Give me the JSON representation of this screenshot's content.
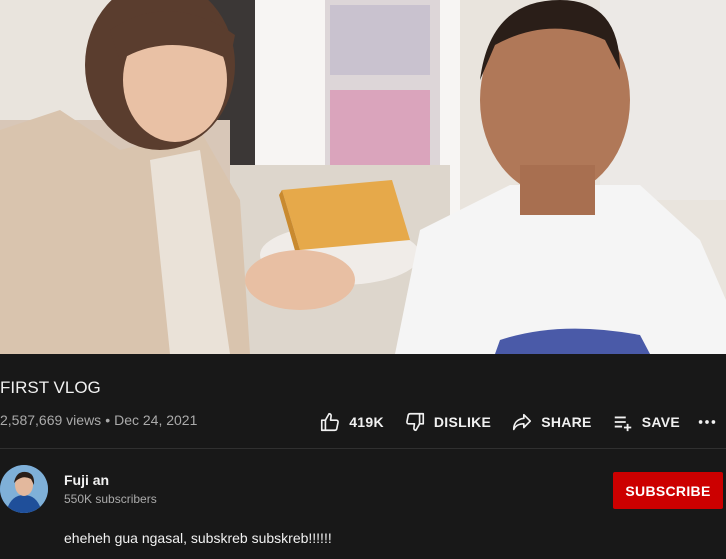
{
  "video": {
    "title": "FIRST VLOG",
    "views": "2,587,669 views",
    "date": "Dec 24, 2021",
    "separator": "•"
  },
  "actions": {
    "like": {
      "icon": "thumb-up-icon",
      "label": "419K"
    },
    "dislike": {
      "icon": "thumb-down-icon",
      "label": "DISLIKE"
    },
    "share": {
      "icon": "share-icon",
      "label": "SHARE"
    },
    "save": {
      "icon": "playlist-add-icon",
      "label": "SAVE"
    },
    "more": {
      "icon": "more-horizontal-icon"
    }
  },
  "channel": {
    "name": "Fuji an",
    "subscribers": "550K subscribers",
    "subscribe_label": "SUBSCRIBE"
  },
  "description": "eheheh gua ngasal, subskreb subskreb!!!!!!",
  "colors": {
    "background": "#181818",
    "text": "#f1f1f1",
    "secondary_text": "#aaaaaa",
    "subscribe": "#cc0000",
    "divider": "#303030"
  }
}
